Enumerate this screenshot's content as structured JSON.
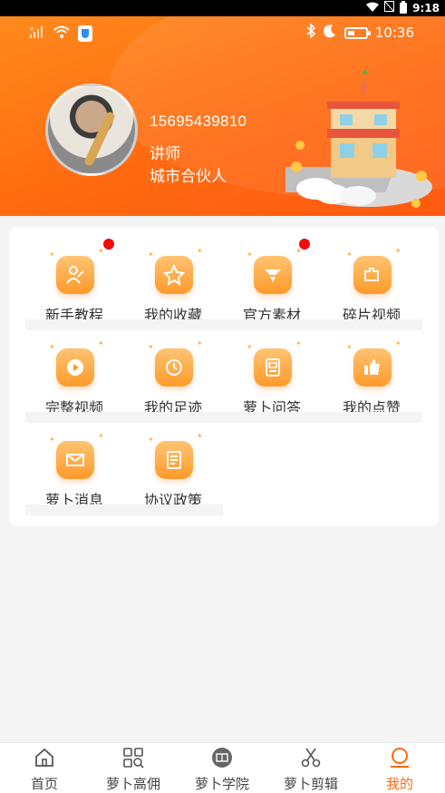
{
  "system_bar": {
    "time": "9:18"
  },
  "status_bar": {
    "time": "10:36"
  },
  "profile": {
    "phone": "15695439810",
    "role": "讲师",
    "title": "城市合伙人"
  },
  "menu": [
    {
      "label": "新手教程",
      "icon": "tutorial-icon",
      "badge": true
    },
    {
      "label": "我的收藏",
      "icon": "star-icon",
      "badge": false
    },
    {
      "label": "官方素材",
      "icon": "material-icon",
      "badge": true
    },
    {
      "label": "碎片视频",
      "icon": "puzzle-icon",
      "badge": false
    },
    {
      "label": "完整视频",
      "icon": "play-icon",
      "badge": false
    },
    {
      "label": "我的足迹",
      "icon": "history-icon",
      "badge": false
    },
    {
      "label": "萝卜问答",
      "icon": "qa-icon",
      "badge": false
    },
    {
      "label": "我的点赞",
      "icon": "thumbs-up-icon",
      "badge": false
    },
    {
      "label": "萝卜消息",
      "icon": "mail-icon",
      "badge": false
    },
    {
      "label": "协议政策",
      "icon": "document-icon",
      "badge": false
    }
  ],
  "tabs": [
    {
      "label": "首页",
      "icon": "home-icon",
      "active": false
    },
    {
      "label": "萝卜高佣",
      "icon": "grid-search-icon",
      "active": false
    },
    {
      "label": "萝卜学院",
      "icon": "academy-icon",
      "active": false
    },
    {
      "label": "萝卜剪辑",
      "icon": "scissors-icon",
      "active": false
    },
    {
      "label": "我的",
      "icon": "profile-icon",
      "active": true
    }
  ],
  "colors": {
    "accent": "#ff6a10",
    "badge": "#f20b0b",
    "icon_gradient_top": "#ffc472",
    "icon_gradient_bottom": "#ff9a2a"
  }
}
